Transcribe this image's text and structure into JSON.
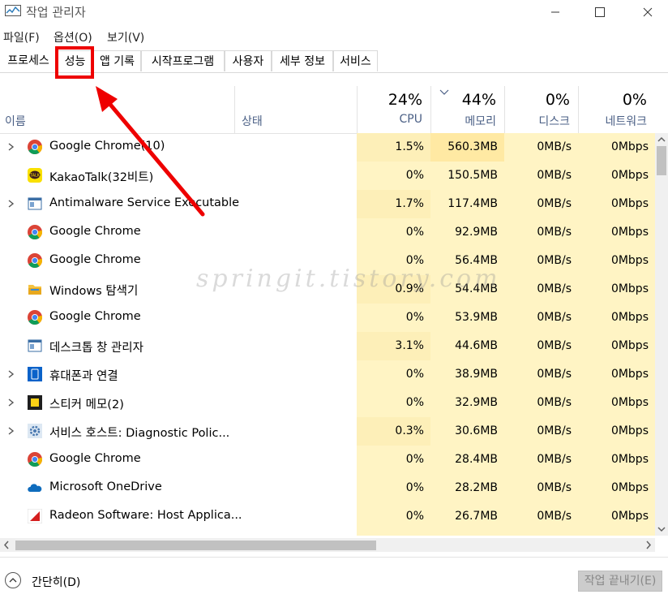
{
  "window": {
    "title": "작업 관리자",
    "minimize": "—",
    "maximize": "☐",
    "close": "✕"
  },
  "menu": [
    "파일(F)",
    "옵션(O)",
    "보기(V)"
  ],
  "tabs": [
    "프로세스",
    "성능",
    "앱 기록",
    "시작프로그램",
    "사용자",
    "세부 정보",
    "서비스"
  ],
  "highlighted_tab": "성능",
  "header": {
    "name": "이름",
    "status": "상태",
    "cpu": {
      "pct": "24%",
      "label": "CPU"
    },
    "memory": {
      "pct": "44%",
      "label": "메모리"
    },
    "disk": {
      "pct": "0%",
      "label": "디스크"
    },
    "network": {
      "pct": "0%",
      "label": "네트워크"
    }
  },
  "processes": [
    {
      "name": "Google Chrome(10)",
      "icon": "chrome-icon",
      "expandable": true,
      "cpu": "1.5%",
      "mem": "560.3MB",
      "disk": "0MB/s",
      "net": "0Mbps"
    },
    {
      "name": "KakaoTalk(32비트)",
      "icon": "kakaotalk-icon",
      "expandable": false,
      "cpu": "0%",
      "mem": "150.5MB",
      "disk": "0MB/s",
      "net": "0Mbps"
    },
    {
      "name": "Antimalware Service Executable",
      "icon": "window-icon",
      "expandable": true,
      "cpu": "1.7%",
      "mem": "117.4MB",
      "disk": "0MB/s",
      "net": "0Mbps"
    },
    {
      "name": "Google Chrome",
      "icon": "chrome-icon",
      "expandable": false,
      "cpu": "0%",
      "mem": "92.9MB",
      "disk": "0MB/s",
      "net": "0Mbps"
    },
    {
      "name": "Google Chrome",
      "icon": "chrome-icon",
      "expandable": false,
      "cpu": "0%",
      "mem": "56.4MB",
      "disk": "0MB/s",
      "net": "0Mbps"
    },
    {
      "name": "Windows 탐색기",
      "icon": "folder-icon",
      "expandable": false,
      "cpu": "0.9%",
      "mem": "54.4MB",
      "disk": "0MB/s",
      "net": "0Mbps"
    },
    {
      "name": "Google Chrome",
      "icon": "chrome-icon",
      "expandable": false,
      "cpu": "0%",
      "mem": "53.9MB",
      "disk": "0MB/s",
      "net": "0Mbps"
    },
    {
      "name": "데스크톱 창 관리자",
      "icon": "window-icon",
      "expandable": false,
      "cpu": "3.1%",
      "mem": "44.6MB",
      "disk": "0MB/s",
      "net": "0Mbps"
    },
    {
      "name": "휴대폰과 연결",
      "icon": "phone-link-icon",
      "expandable": true,
      "cpu": "0%",
      "mem": "38.9MB",
      "disk": "0MB/s",
      "net": "0Mbps"
    },
    {
      "name": "스티커 메모(2)",
      "icon": "sticky-notes-icon",
      "expandable": true,
      "cpu": "0%",
      "mem": "32.9MB",
      "disk": "0MB/s",
      "net": "0Mbps"
    },
    {
      "name": "서비스 호스트: Diagnostic Polic...",
      "icon": "gear-icon",
      "expandable": true,
      "cpu": "0.3%",
      "mem": "30.6MB",
      "disk": "0MB/s",
      "net": "0Mbps"
    },
    {
      "name": "Google Chrome",
      "icon": "chrome-icon",
      "expandable": false,
      "cpu": "0%",
      "mem": "28.4MB",
      "disk": "0MB/s",
      "net": "0Mbps"
    },
    {
      "name": "Microsoft OneDrive",
      "icon": "onedrive-icon",
      "expandable": false,
      "cpu": "0%",
      "mem": "28.2MB",
      "disk": "0MB/s",
      "net": "0Mbps"
    },
    {
      "name": "Radeon Software: Host Applica...",
      "icon": "radeon-icon",
      "expandable": false,
      "cpu": "0%",
      "mem": "26.7MB",
      "disk": "0MB/s",
      "net": "0Mbps"
    },
    {
      "name": "",
      "icon": "",
      "expandable": false,
      "cpu": "",
      "mem": "",
      "disk": "",
      "net": ""
    }
  ],
  "footer": {
    "collapse": "간단히(D)",
    "end_task": "작업 끝내기(E)"
  },
  "watermark": "springit.tistory.com",
  "colors": {
    "highlight": "#ee0000",
    "cell_light": "#fff4c4",
    "cell_mem_dark": "#ffe9a3",
    "cell_cpu_mid": "#fdefb8"
  }
}
